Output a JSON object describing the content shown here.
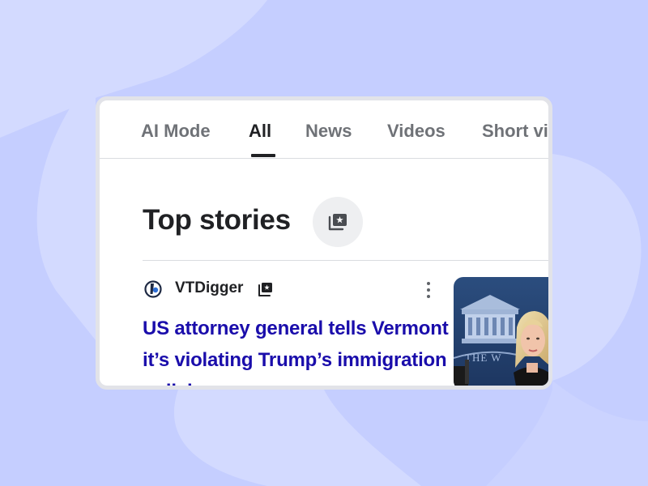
{
  "tabs": [
    {
      "label": "AI Mode",
      "active": false
    },
    {
      "label": "All",
      "active": true
    },
    {
      "label": "News",
      "active": false
    },
    {
      "label": "Videos",
      "active": false
    },
    {
      "label": "Short vi",
      "active": false
    }
  ],
  "section": {
    "title": "Top stories",
    "icon": "stories-collection-icon"
  },
  "story": {
    "source": "VTDigger",
    "source_icon": "vtdigger-logo-icon",
    "badge_icon": "top-story-badge-icon",
    "menu_icon": "more-vert-icon",
    "headline": "US attorney general tells Vermont it’s violating Trump’s immigration policies"
  },
  "colors": {
    "background": "#c5ceff",
    "card": "#ffffff",
    "link": "#1a0dab",
    "text": "#202124",
    "muted_tab": "#6f7277"
  }
}
